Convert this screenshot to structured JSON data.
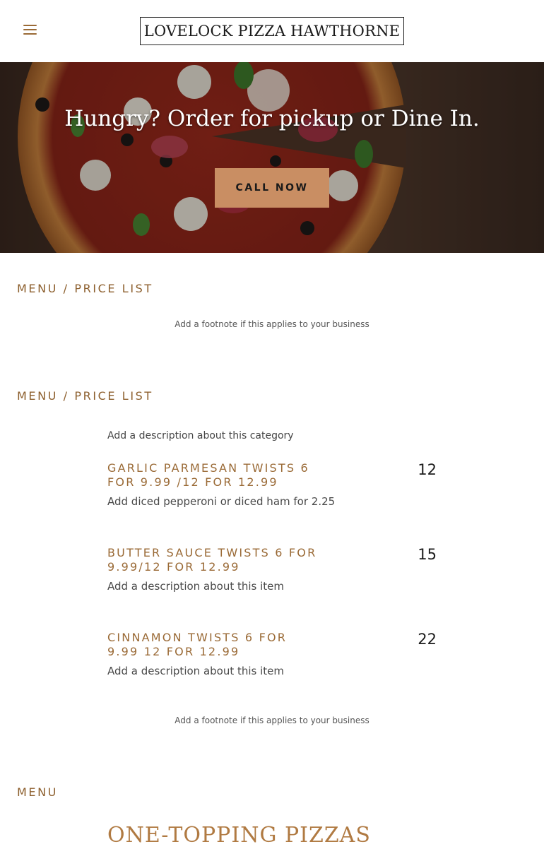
{
  "header": {
    "logo_text": "LOVELOCK PIZZA HAWTHORNE",
    "menu_icon": "hamburger-menu-icon"
  },
  "hero": {
    "title": "Hungry? Order for pickup or Dine In.",
    "cta_label": "CALL NOW"
  },
  "section1": {
    "title": "MENU / PRICE LIST",
    "footnote": "Add a footnote if this applies to your business"
  },
  "section2": {
    "title": "MENU / PRICE LIST",
    "category_description": "Add a description about this category",
    "items": [
      {
        "name": "GARLIC PARMESAN TWISTS 6 FOR 9.99 /12 FOR 12.99",
        "description": "Add diced pepperoni or diced ham for 2.25",
        "price": "12"
      },
      {
        "name": "BUTTER SAUCE TWISTS 6 FOR 9.99/12 FOR 12.99",
        "description": "Add a description about this item",
        "price": "15"
      },
      {
        "name": "CINNAMON TWISTS 6 FOR 9.99 12 FOR 12.99",
        "description": "Add a description about this item",
        "price": "22"
      }
    ],
    "footnote": "Add a footnote if this applies to your business"
  },
  "section3": {
    "title": "MENU",
    "subtitle": "ONE-TOPPING PIZZAS"
  },
  "colors": {
    "accent": "#9a6a36",
    "cta": "#c98e63",
    "hero_bg": "#4b3225"
  }
}
